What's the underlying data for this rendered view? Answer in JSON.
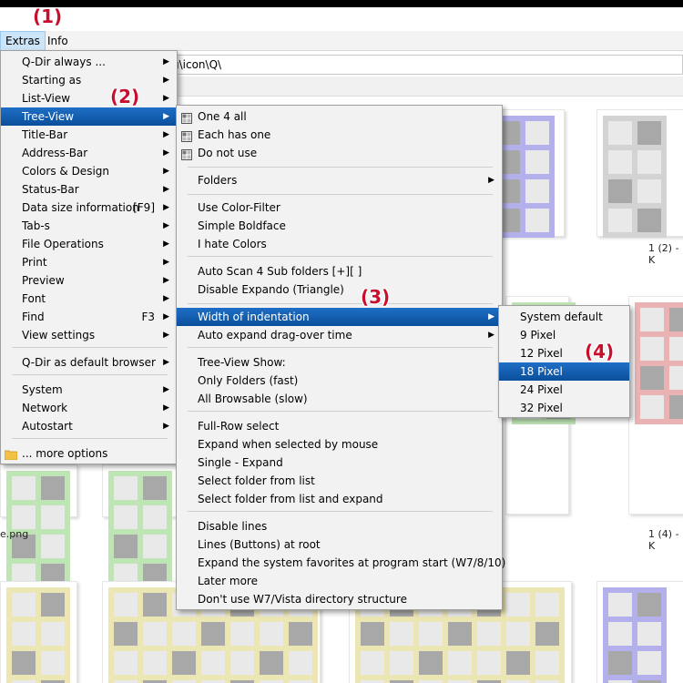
{
  "menubar": {
    "extras": "Extras",
    "info": "Info"
  },
  "address_path": "g\\icon\\Q\\",
  "captions": [
    "1 (2) - K",
    "e.png",
    "1 (4) - K"
  ],
  "annotations": [
    "(1)",
    "(2)",
    "(3)",
    "(4)"
  ],
  "extras_menu": [
    {
      "label": "Q-Dir always ...",
      "submenu": true
    },
    {
      "label": "Starting as",
      "submenu": true
    },
    {
      "label": "List-View",
      "submenu": true
    },
    {
      "label": "Tree-View",
      "submenu": true,
      "highlighted": true
    },
    {
      "label": "Title-Bar",
      "submenu": true
    },
    {
      "label": "Address-Bar",
      "submenu": true
    },
    {
      "label": "Colors & Design",
      "submenu": true
    },
    {
      "label": "Status-Bar",
      "submenu": true
    },
    {
      "label": "Data size information",
      "shortcut": "[F9]",
      "submenu": true
    },
    {
      "label": "Tab-s",
      "submenu": true
    },
    {
      "label": "File Operations",
      "submenu": true
    },
    {
      "label": "Print",
      "submenu": true
    },
    {
      "label": "Preview",
      "submenu": true
    },
    {
      "label": "Font",
      "submenu": true
    },
    {
      "label": "Find",
      "shortcut": "F3",
      "submenu": true
    },
    {
      "label": "View settings",
      "submenu": true
    },
    {
      "label": "Q-Dir as default browser",
      "submenu": true
    },
    {
      "label": "System",
      "submenu": true
    },
    {
      "label": "Network",
      "submenu": true
    },
    {
      "label": "Autostart",
      "submenu": true
    },
    {
      "label": "... more options",
      "icon": "folder-icon"
    }
  ],
  "treeview_menu": [
    {
      "label": "One 4 all",
      "icon": "layout-icon"
    },
    {
      "label": "Each has one",
      "icon": "layout-icon"
    },
    {
      "label": "Do not use",
      "icon": "layout-icon"
    },
    {
      "label": "Folders",
      "submenu": true
    },
    {
      "label": "Use Color-Filter"
    },
    {
      "label": "Simple Boldface"
    },
    {
      "label": "I hate Colors"
    },
    {
      "label": "Auto Scan 4 Sub folders  [+][ ]"
    },
    {
      "label": "Disable Expando (Triangle)"
    },
    {
      "label": "Width of indentation",
      "submenu": true,
      "highlighted": true
    },
    {
      "label": "Auto expand drag-over time",
      "submenu": true
    },
    {
      "label": "Tree-View Show:"
    },
    {
      "label": "Only Folders (fast)"
    },
    {
      "label": "All Browsable (slow)"
    },
    {
      "label": "Full-Row select"
    },
    {
      "label": "Expand when selected by mouse"
    },
    {
      "label": "Single - Expand"
    },
    {
      "label": "Select folder from list"
    },
    {
      "label": "Select folder from list and expand"
    },
    {
      "label": "Disable lines"
    },
    {
      "label": "Lines (Buttons) at root"
    },
    {
      "label": "Expand the system favorites at program start (W7/8/10)"
    },
    {
      "label": "Later more"
    },
    {
      "label": "Don't use W7/Vista directory structure"
    }
  ],
  "indent_menu": [
    {
      "label": "System default"
    },
    {
      "label": "9 Pixel"
    },
    {
      "label": "12 Pixel"
    },
    {
      "label": "18 Pixel",
      "highlighted": true
    },
    {
      "label": "24 Pixel"
    },
    {
      "label": "32 Pixel"
    }
  ],
  "colors": {
    "highlight": "#0b5ab0",
    "annotation": "#c8102e",
    "tile_blue": "#b3b0ec",
    "tile_gray": "#d3d3d3",
    "tile_green": "#bfe4b5",
    "tile_red": "#eab3b3",
    "tile_yellow": "#ece5b4"
  }
}
